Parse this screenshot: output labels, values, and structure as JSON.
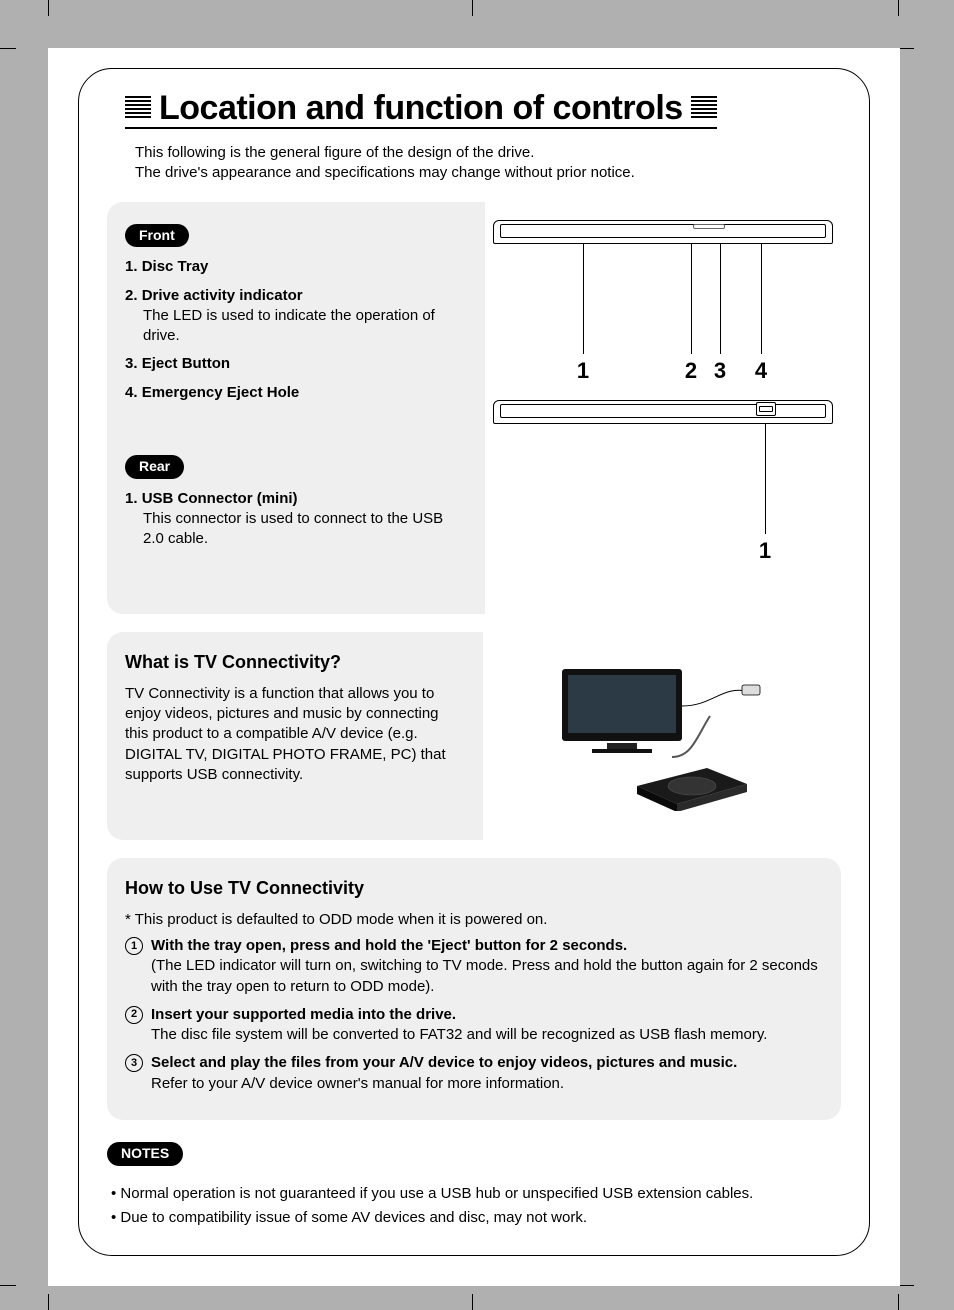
{
  "title": "Location and function of controls",
  "intro_line1": "This following is the general figure of the design of the drive.",
  "intro_line2": "The drive's appearance and specifications may change without prior notice.",
  "front": {
    "heading": "Front",
    "items": [
      {
        "num": "1.",
        "label": "Disc Tray",
        "desc": ""
      },
      {
        "num": "2.",
        "label": "Drive activity indicator",
        "desc": "The LED is used to indicate the operation of drive."
      },
      {
        "num": "3.",
        "label": "Eject Button",
        "desc": ""
      },
      {
        "num": "4.",
        "label": "Emergency Eject Hole",
        "desc": ""
      }
    ],
    "callouts": [
      "1",
      "2",
      "3",
      "4"
    ]
  },
  "rear": {
    "heading": "Rear",
    "items": [
      {
        "num": "1.",
        "label": "USB Connector (mini)",
        "desc": "This connector is used to connect to the USB 2.0 cable."
      }
    ],
    "callouts": [
      "1"
    ]
  },
  "tv_what": {
    "heading": "What is TV Connectivity?",
    "body": "TV Connectivity is a function that allows you to enjoy videos, pictures and music by connecting this product to a compatible A/V device (e.g. DIGITAL TV, DIGITAL PHOTO FRAME, PC) that supports USB connectivity."
  },
  "tv_how": {
    "heading": "How to Use TV Connectivity",
    "note": "* This product is defaulted to ODD mode when it is powered on.",
    "steps": [
      {
        "n": "1",
        "head": "With the tray open, press and hold the 'Eject' button for 2 seconds.",
        "sub": "(The LED indicator will turn on, switching to TV mode. Press and hold the button again for 2 seconds with the tray open to return to ODD mode)."
      },
      {
        "n": "2",
        "head": "Insert your supported media into the drive.",
        "sub": "The disc file system will be converted to FAT32 and will be recognized as USB flash memory."
      },
      {
        "n": "3",
        "head": "Select and play the files from your A/V device to enjoy videos, pictures and music.",
        "sub": "Refer to your A/V device owner's manual for more information."
      }
    ]
  },
  "notes": {
    "heading": "NOTES",
    "items": [
      "Normal operation is not guaranteed if you use a USB hub or unspecified USB extension cables.",
      "Due to compatibility issue of some AV devices and disc, may not work."
    ]
  }
}
